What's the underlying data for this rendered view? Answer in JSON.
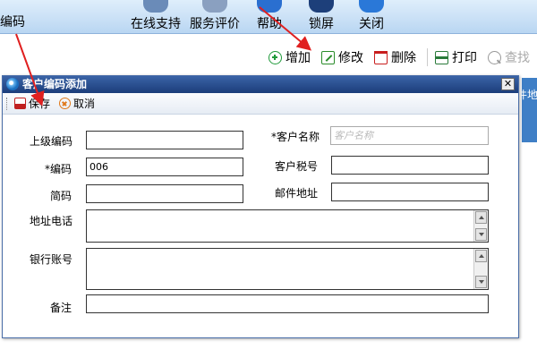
{
  "topbar": {
    "left_label": "编码",
    "items": [
      {
        "label": "在线支持",
        "icon": "support-icon",
        "color": "#6a8bb8"
      },
      {
        "label": "服务评价",
        "icon": "evaluate-icon",
        "color": "#8aa0c0"
      },
      {
        "label": "帮助",
        "icon": "help-icon",
        "color": "#2a6fd0"
      },
      {
        "label": "锁屏",
        "icon": "lock-screen-icon",
        "color": "#1d3f7a"
      },
      {
        "label": "关闭",
        "icon": "close-app-icon",
        "color": "#2a78d8"
      }
    ]
  },
  "toolbar": {
    "add": "增加",
    "edit": "修改",
    "delete": "删除",
    "print": "打印",
    "find": "查找"
  },
  "right_strip_text": "件地",
  "dialog": {
    "title": "客户编码添加",
    "save": "保存",
    "cancel": "取消",
    "fields": {
      "parent_code_label": "上级编码",
      "parent_code_value": "",
      "customer_name_label": "*客户名称",
      "customer_name_placeholder": "客户名称",
      "code_label": "*编码",
      "code_value": "006",
      "tax_no_label": "客户税号",
      "tax_no_value": "",
      "short_code_label": "简码",
      "short_code_value": "",
      "email_label": "邮件地址",
      "email_value": "",
      "address_phone_label": "地址电话",
      "bank_account_label": "银行账号",
      "remark_label": "备注",
      "remark_value": ""
    }
  },
  "colors": {
    "title_bar": "#1c3d7a",
    "annotation_arrow": "#e02020"
  }
}
